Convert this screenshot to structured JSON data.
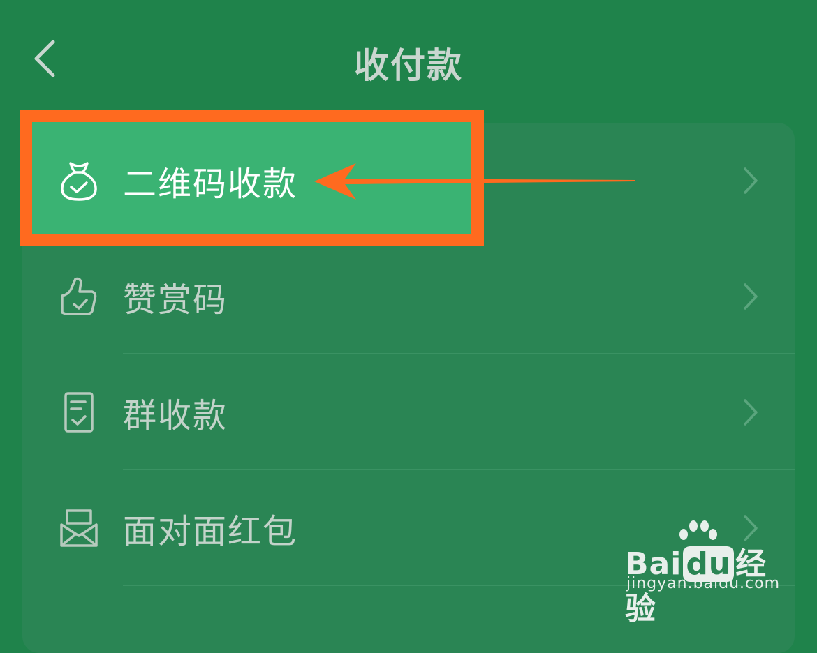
{
  "header": {
    "title": "收付款"
  },
  "menu": {
    "items": [
      {
        "label": "二维码收款"
      },
      {
        "label": "赞赏码"
      },
      {
        "label": "群收款"
      },
      {
        "label": "面对面红包"
      }
    ]
  },
  "watermark": {
    "brand_left": "Bai",
    "brand_mid": "du",
    "brand_right": "经验",
    "url": "jingyan.baidu.com"
  },
  "colors": {
    "background": "#1f834b",
    "card": "#2a8554",
    "highlight_fill": "#3ab373",
    "annotation": "#ff6a1f"
  },
  "icons": [
    "back-arrow-icon",
    "money-bag-icon",
    "thumbs-up-icon",
    "receipt-icon",
    "red-packet-icon",
    "chevron-right-icon",
    "orange-arrow-annotation"
  ]
}
